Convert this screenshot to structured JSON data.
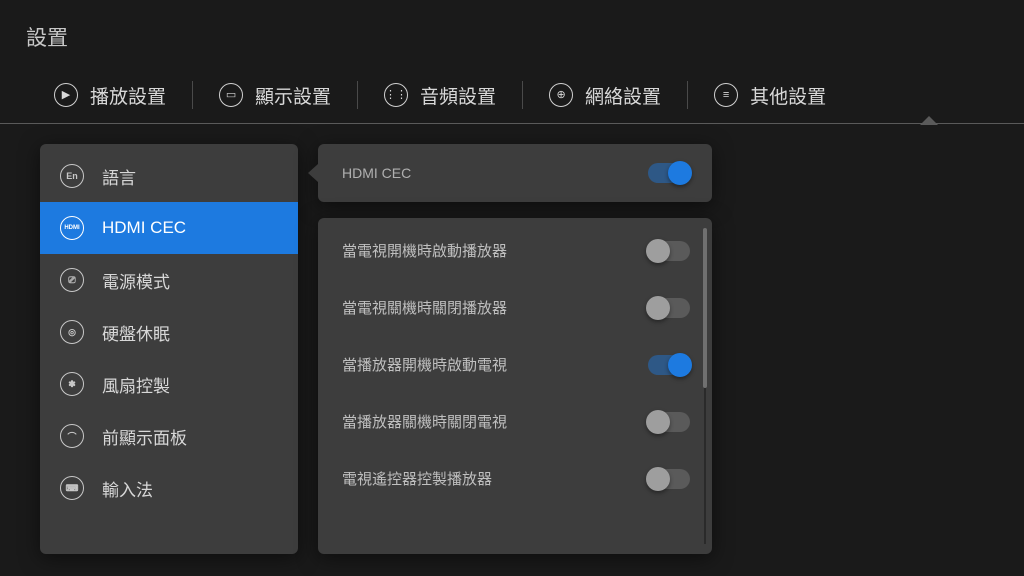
{
  "page_title": "設置",
  "tabs": [
    {
      "id": "playback",
      "label": "播放設置",
      "icon": "play"
    },
    {
      "id": "display",
      "label": "顯示設置",
      "icon": "monitor"
    },
    {
      "id": "audio",
      "label": "音頻設置",
      "icon": "equalizer"
    },
    {
      "id": "network",
      "label": "網絡設置",
      "icon": "globe"
    },
    {
      "id": "other",
      "label": "其他設置",
      "icon": "list",
      "active": true
    }
  ],
  "sidebar": {
    "items": [
      {
        "id": "language",
        "label": "語言",
        "icon_text": "En"
      },
      {
        "id": "hdmi-cec",
        "label": "HDMI CEC",
        "icon_text": "HDMI",
        "selected": true
      },
      {
        "id": "power-mode",
        "label": "電源模式",
        "icon_text": "⎚"
      },
      {
        "id": "hdd-sleep",
        "label": "硬盤休眠",
        "icon_text": "◎"
      },
      {
        "id": "fan",
        "label": "風扇控製",
        "icon_text": "✽"
      },
      {
        "id": "front-panel",
        "label": "前顯示面板",
        "icon_text": "⌒"
      },
      {
        "id": "input",
        "label": "輸入法",
        "icon_text": "⌨"
      }
    ]
  },
  "content": {
    "header_label": "HDMI CEC",
    "header_toggle": true,
    "options": [
      {
        "label": "當電視開機時啟動播放器",
        "value": false
      },
      {
        "label": "當電視關機時關閉播放器",
        "value": false
      },
      {
        "label": "當播放器開機時啟動電視",
        "value": true
      },
      {
        "label": "當播放器關機時關閉電視",
        "value": false
      },
      {
        "label": "電視遙控器控製播放器",
        "value": false
      }
    ]
  },
  "icon_glyphs": {
    "play": "▶",
    "monitor": "▭",
    "equalizer": "⋮⋮",
    "globe": "⊕",
    "list": "≡"
  }
}
